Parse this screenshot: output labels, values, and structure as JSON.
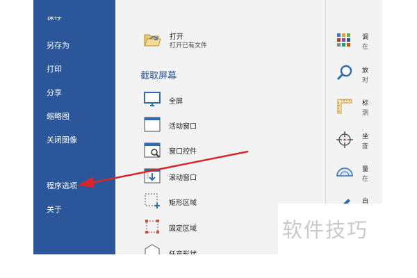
{
  "sidebar": {
    "items": [
      {
        "label": "保存"
      },
      {
        "label": "另存为"
      },
      {
        "label": "打印"
      },
      {
        "label": "分享"
      },
      {
        "label": "缩略图"
      },
      {
        "label": "关闭图像"
      },
      {
        "label": "程序选项"
      },
      {
        "label": "关于"
      }
    ]
  },
  "open": {
    "title": "打开",
    "desc": "打开已有文件"
  },
  "capture": {
    "heading": "截取屏幕",
    "items": [
      {
        "label": "全屏",
        "icon": "monitor-icon"
      },
      {
        "label": "活动窗口",
        "icon": "window-icon"
      },
      {
        "label": "窗口控件",
        "icon": "window-control-icon"
      },
      {
        "label": "滚动窗口",
        "icon": "scroll-window-icon"
      },
      {
        "label": "矩形区域",
        "icon": "rect-region-icon"
      },
      {
        "label": "固定区域",
        "icon": "fixed-region-icon"
      },
      {
        "label": "任意形状",
        "icon": "freeform-icon"
      }
    ]
  },
  "tools": {
    "items": [
      {
        "title": "调",
        "desc": "在",
        "icon": "color-palette-icon"
      },
      {
        "title": "放",
        "desc": "对",
        "icon": "magnifier-icon"
      },
      {
        "title": "标",
        "desc": "测",
        "icon": "ruler-icon"
      },
      {
        "title": "坐",
        "desc": "查",
        "icon": "crosshair-icon"
      },
      {
        "title": "量",
        "desc": "在",
        "icon": "protractor-icon"
      },
      {
        "title": "白",
        "desc": "",
        "icon": "pen-icon"
      }
    ]
  },
  "watermark": "软件技巧",
  "colors": {
    "sidebar": "#2b579a",
    "arrow": "#d9262b",
    "panel": "#f3f3f3"
  }
}
